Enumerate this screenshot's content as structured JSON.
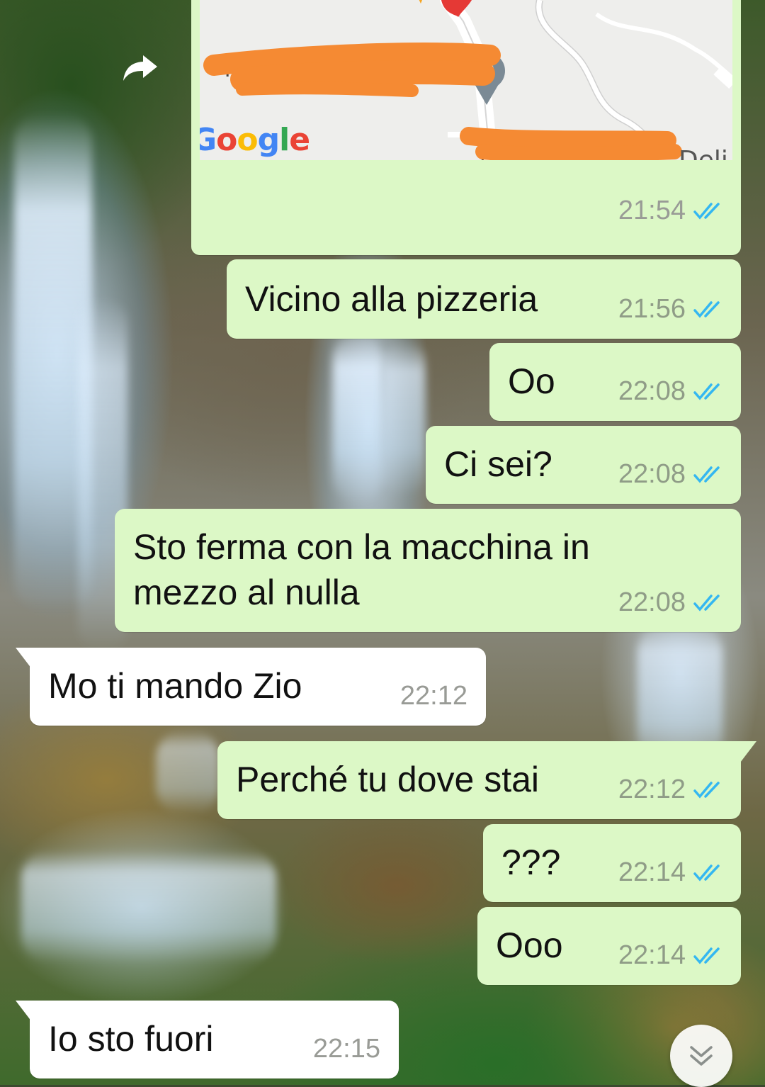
{
  "map_message": {
    "google_logo": "Google",
    "place_label": "Deli",
    "time": "21:54",
    "status_icon": "double-check-icon"
  },
  "messages": [
    {
      "direction": "out",
      "text": "Vicino alla pizzeria",
      "time": "21:56",
      "status_icon": "double-check-icon"
    },
    {
      "direction": "out",
      "text": "Oo",
      "time": "22:08",
      "status_icon": "double-check-icon"
    },
    {
      "direction": "out",
      "text": "Ci sei?",
      "time": "22:08",
      "status_icon": "double-check-icon"
    },
    {
      "direction": "out",
      "text_line1": "Sto ferma con la macchina in",
      "text_line2": "mezzo al nulla",
      "time": "22:08",
      "status_icon": "double-check-icon"
    },
    {
      "direction": "in",
      "text": "Mo ti mando Zio",
      "time": "22:12"
    },
    {
      "direction": "out",
      "text": "Perché tu dove stai",
      "time": "22:12",
      "status_icon": "double-check-icon"
    },
    {
      "direction": "out",
      "text": "???",
      "time": "22:14",
      "status_icon": "double-check-icon"
    },
    {
      "direction": "out",
      "text": "Ooo",
      "time": "22:14",
      "status_icon": "double-check-icon"
    },
    {
      "direction": "in",
      "text": "Io sto fuori",
      "time": "22:15"
    }
  ],
  "icons": {
    "forward": "forward-icon",
    "scroll_down": "chevron-double-down-icon"
  },
  "colors": {
    "outgoing_bubble": "#dcf8c6",
    "incoming_bubble": "#ffffff",
    "read_ticks": "#34b7f1",
    "redaction": "#f58a33"
  }
}
